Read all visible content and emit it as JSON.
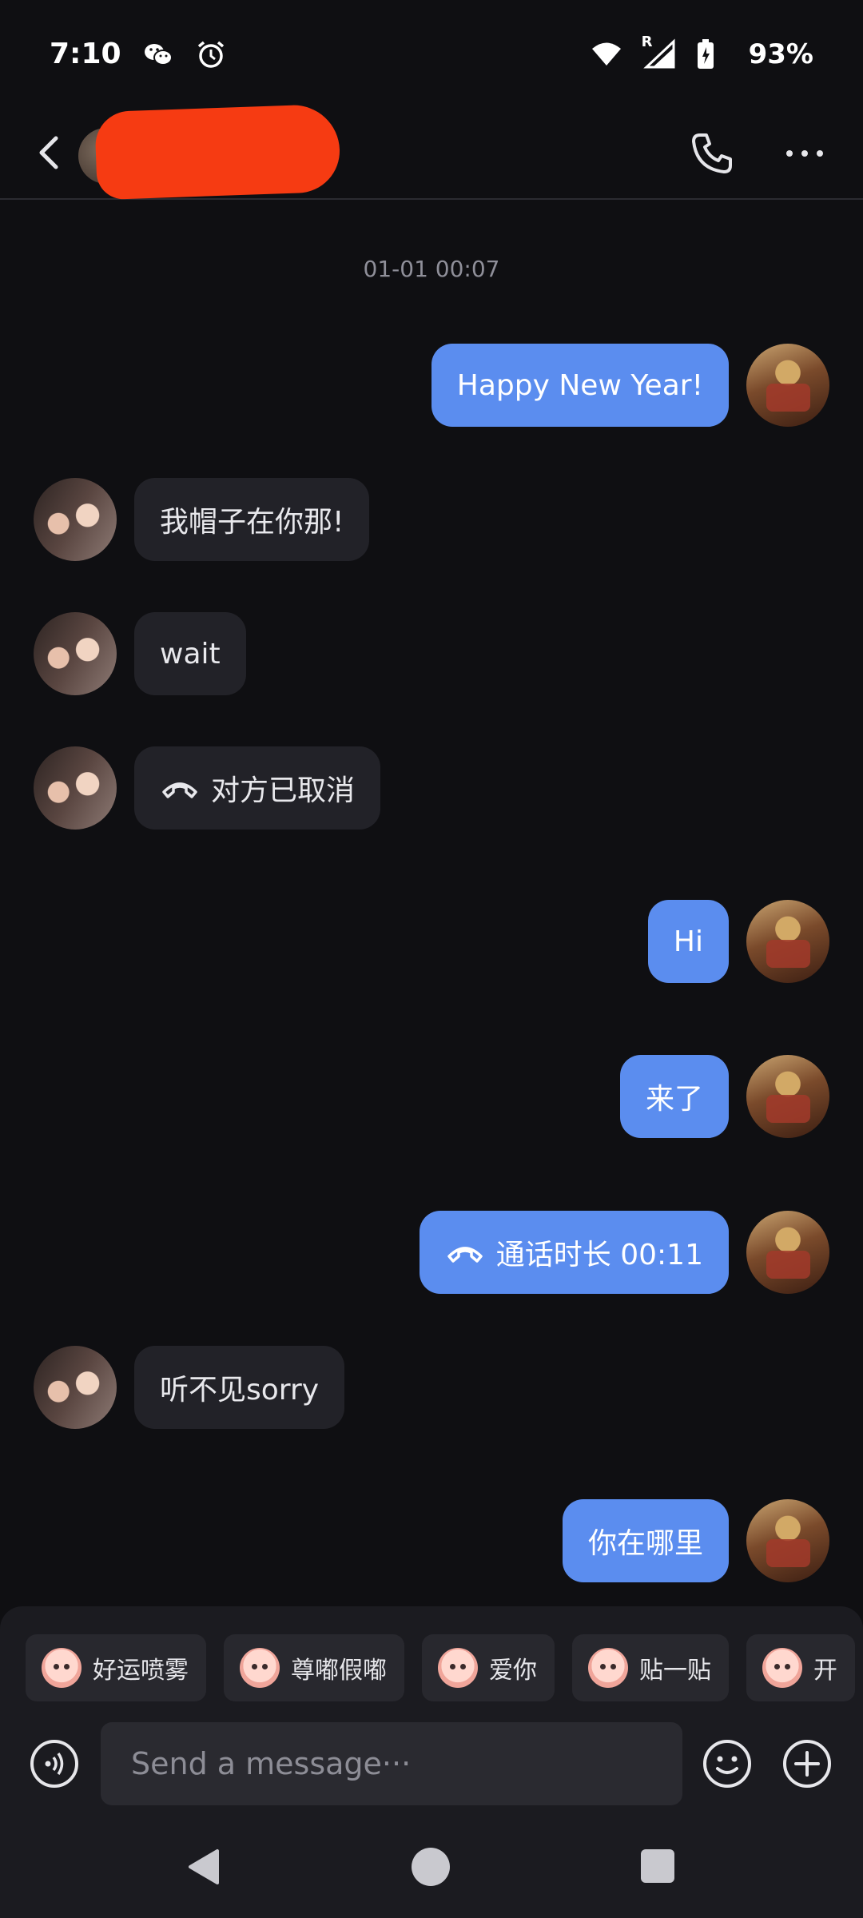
{
  "status_bar": {
    "time": "7:10",
    "battery": "93%",
    "network_label": "R",
    "icons": [
      "wechat-icon",
      "alarm-icon",
      "wifi-icon",
      "signal-icon",
      "battery-icon"
    ]
  },
  "header": {
    "name_redacted": true,
    "icons": [
      "back-icon",
      "phone-icon",
      "more-icon"
    ]
  },
  "chat": {
    "timestamp": "01-01 00:07",
    "messages": [
      {
        "side": "out",
        "text": "Happy New Year!"
      },
      {
        "side": "in",
        "text": "我帽子在你那!"
      },
      {
        "side": "in",
        "text": "wait"
      },
      {
        "side": "in",
        "text": "对方已取消",
        "icon": "hangup-icon"
      },
      {
        "side": "out",
        "text": "Hi"
      },
      {
        "side": "out",
        "text": "来了"
      },
      {
        "side": "out",
        "text": "通话时长 00:11",
        "icon": "hangup-icon"
      },
      {
        "side": "in",
        "text": "听不见sorry"
      },
      {
        "side": "out",
        "text": "你在哪里"
      }
    ]
  },
  "quick_replies": [
    "好运喷雾",
    "尊嘟假嘟",
    "爱你",
    "贴一贴",
    "开"
  ],
  "composer": {
    "placeholder": "Send a message···",
    "icons": [
      "voice-icon",
      "emoji-icon",
      "plus-icon"
    ]
  },
  "colors": {
    "background": "#0f0f12",
    "outgoing_bubble": "#5b8def",
    "incoming_bubble": "#222228",
    "redaction": "#f63b12"
  }
}
